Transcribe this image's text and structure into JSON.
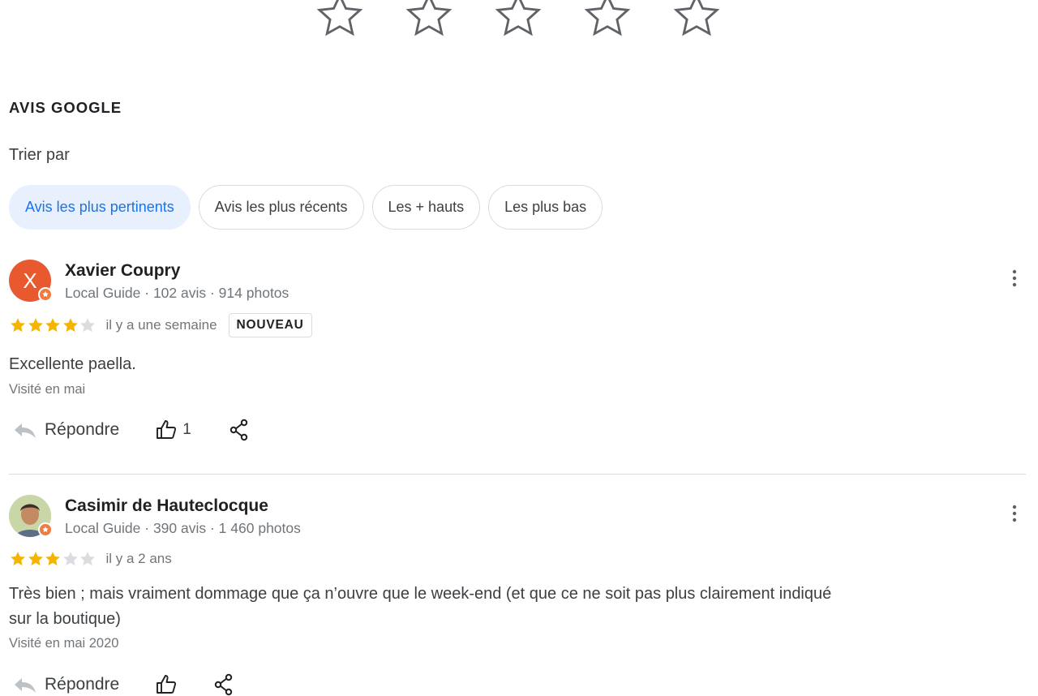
{
  "rating_prompt": {
    "star_count": 5
  },
  "section": {
    "title": "AVIS GOOGLE",
    "sort_label": "Trier par"
  },
  "sort_chips": [
    {
      "label": "Avis les plus pertinents",
      "selected": true
    },
    {
      "label": "Avis les plus récents",
      "selected": false
    },
    {
      "label": "Les + hauts",
      "selected": false
    },
    {
      "label": "Les plus bas",
      "selected": false
    }
  ],
  "reviews": [
    {
      "author": "Xavier Coupry",
      "avatar_letter": "X",
      "meta": "Local Guide · 102 avis · 914 photos",
      "stars": 4,
      "time": "il y a une semaine",
      "badge": "NOUVEAU",
      "text": "Excellente paella.",
      "visited": "Visité en mai",
      "reply_label": "Répondre",
      "likes": "1"
    },
    {
      "author": "Casimir de Hauteclocque",
      "avatar_letter": "",
      "meta": "Local Guide · 390 avis · 1 460 photos",
      "stars": 3,
      "time": "il y a 2 ans",
      "text_line1": "Très bien ; mais vraiment dommage que ça n’ouvre que le week-end (et que ce ne soit pas plus clairement indiqué",
      "text_line2": "sur la boutique)",
      "visited": "Visité en mai 2020",
      "reply_label": "Répondre"
    }
  ],
  "colors": {
    "star_filled": "#f4b400",
    "star_empty": "#dadce0",
    "chip_active_bg": "#e8f0fe",
    "chip_active_text": "#1a73e8",
    "avatar_bg": "#e9592f",
    "local_guide_badge": "#f07b3f"
  },
  "icons": {
    "rate_star": "star-outline-icon",
    "more": "more-vert-icon",
    "reply": "reply-icon",
    "like": "thumb-up-icon",
    "share": "share-icon",
    "local_guide": "local-guide-badge-icon"
  }
}
